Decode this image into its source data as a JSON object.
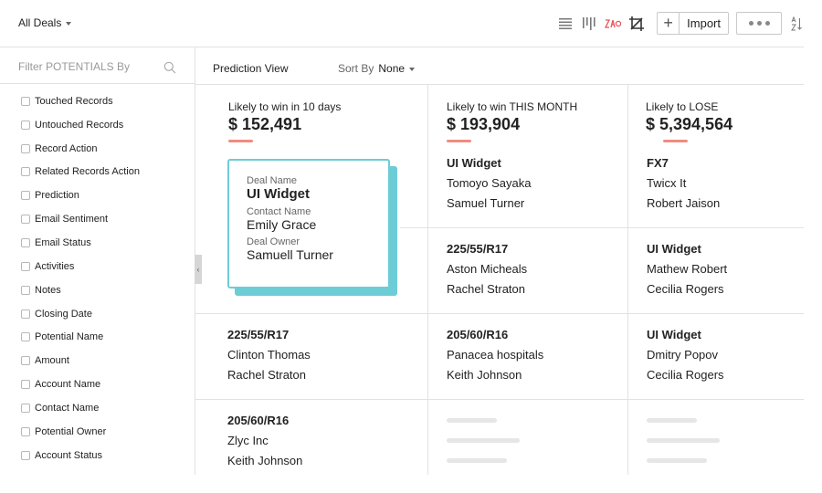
{
  "header": {
    "view_label": "All Deals",
    "import_label": "Import",
    "toolbar_icons": [
      "list-view-icon",
      "kanban-view-icon",
      "chart-view-icon",
      "crop-icon",
      "plus-icon",
      "more-icon",
      "sort-az-icon"
    ],
    "accent_color": "#e8555a"
  },
  "sidebar": {
    "filter_placeholder": "Filter POTENTIALS By",
    "filters": [
      "Touched Records",
      "Untouched Records",
      "Record Action",
      "Related Records Action",
      "Prediction",
      "Email Sentiment",
      "Email Status",
      "Activities",
      "Notes",
      "Closing Date",
      "Potential Name",
      "Amount",
      "Account Name",
      "Contact Name",
      "Potential Owner",
      "Account Status"
    ]
  },
  "subheader": {
    "view_name": "Prediction View",
    "sort_label": "Sort By",
    "sort_value": "None"
  },
  "columns": [
    {
      "title": "Likely to win in 10 days",
      "amount": "$ 152,491",
      "cards": [
        {
          "deal": "225/55/R17",
          "contact": "Clinton Thomas",
          "owner": "Rachel Straton"
        },
        {
          "deal": "205/60/R16",
          "contact": "Zlyc Inc",
          "owner": "Keith Johnson"
        }
      ]
    },
    {
      "title": "Likely to win THIS MONTH",
      "amount": "$ 193,904",
      "cards": [
        {
          "deal": "UI Widget",
          "contact": "Tomoyo Sayaka",
          "owner": "Samuel Turner"
        },
        {
          "deal": "225/55/R17",
          "contact": "Aston Micheals",
          "owner": "Rachel Straton"
        },
        {
          "deal": "205/60/R16",
          "contact": "Panacea hospitals",
          "owner": "Keith Johnson"
        }
      ]
    },
    {
      "title": "Likely to LOSE",
      "amount": "$ 5,394,564",
      "cards": [
        {
          "deal": "FX7",
          "contact": "Twicx It",
          "owner": "Robert Jaison"
        },
        {
          "deal": "UI Widget",
          "contact": "Mathew Robert",
          "owner": "Cecilia Rogers"
        },
        {
          "deal": "UI Widget",
          "contact": "Dmitry Popov",
          "owner": "Cecilia Rogers"
        }
      ]
    }
  ],
  "dragged_card": {
    "deal_label": "Deal Name",
    "deal": "UI Widget",
    "contact_label": "Contact Name",
    "contact": "Emily Grace",
    "owner_label": "Deal Owner",
    "owner": "Samuell Turner",
    "highlight_color": "#6ccdd6"
  }
}
